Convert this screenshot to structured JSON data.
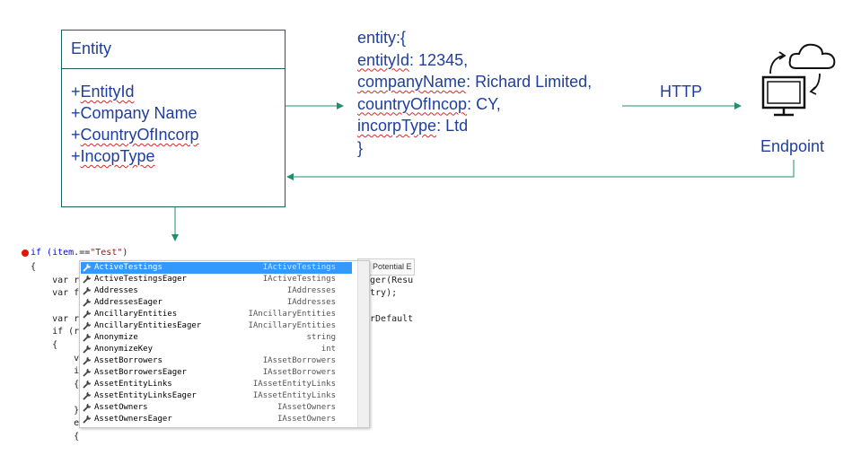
{
  "diagram": {
    "entity_box": {
      "title": "Entity",
      "attributes": [
        {
          "prefix": "+",
          "name": "EntityId"
        },
        {
          "prefix": "+",
          "name": "Company Name"
        },
        {
          "prefix": "+",
          "name": "CountryOfIncorp"
        },
        {
          "prefix": "+",
          "name": "IncopType"
        }
      ]
    },
    "json_lines": {
      "open": "entity:{",
      "l1_key": "entityId",
      "l1_val": ": 12345,",
      "l2_key": "companyName",
      "l2_val": ": Richard Limited,",
      "l3_key": "countryOfIncop",
      "l3_val": ": CY,",
      "l4_key": "incorpType",
      "l4_val": ": Ltd",
      "close": "}"
    },
    "http_label": "HTTP",
    "endpoint_label": "Endpoint",
    "colors": {
      "line": "#1f8f6f",
      "text": "#1f3f9f",
      "squiggle": "#d42a2a"
    },
    "icons": [
      "computer-monitor-icon",
      "cloud-icon",
      "sync-arrows-icon"
    ]
  },
  "code": {
    "line1_a": "if (item.",
    "line1_b": "==",
    "line1_str": "\"Test\"",
    "line1_c": ")",
    "line2": "{",
    "line3_a": "    var r",
    "line3_b": "ager(Resu",
    "line4_a": "    var f",
    "line4_b": "ntry);",
    "line6_a": "    var r",
    "line6_b": "OrDefault",
    "line7": "    if (r",
    "line8": "    {",
    "line9": "        v",
    "line10": "        i",
    "line11": "        {",
    "line13": "        }",
    "line14": "        e",
    "line15": "        {",
    "tooltip": "Potential E"
  },
  "autocomplete": {
    "items": [
      {
        "name": "ActiveTestings",
        "type": "IActiveTestings",
        "selected": true
      },
      {
        "name": "ActiveTestingsEager",
        "type": "IActiveTestings"
      },
      {
        "name": "Addresses",
        "type": "IAddresses"
      },
      {
        "name": "AddressesEager",
        "type": "IAddresses"
      },
      {
        "name": "AncillaryEntities",
        "type": "IAncillaryEntities"
      },
      {
        "name": "AncillaryEntitiesEager",
        "type": "IAncillaryEntities"
      },
      {
        "name": "Anonymize",
        "type": "string"
      },
      {
        "name": "AnonymizeKey",
        "type": "int"
      },
      {
        "name": "AssetBorrowers",
        "type": "IAssetBorrowers"
      },
      {
        "name": "AssetBorrowersEager",
        "type": "IAssetBorrowers"
      },
      {
        "name": "AssetEntityLinks",
        "type": "IAssetEntityLinks"
      },
      {
        "name": "AssetEntityLinksEager",
        "type": "IAssetEntityLinks"
      },
      {
        "name": "AssetOwners",
        "type": "IAssetOwners"
      },
      {
        "name": "AssetOwnersEager",
        "type": "IAssetOwners"
      }
    ]
  }
}
